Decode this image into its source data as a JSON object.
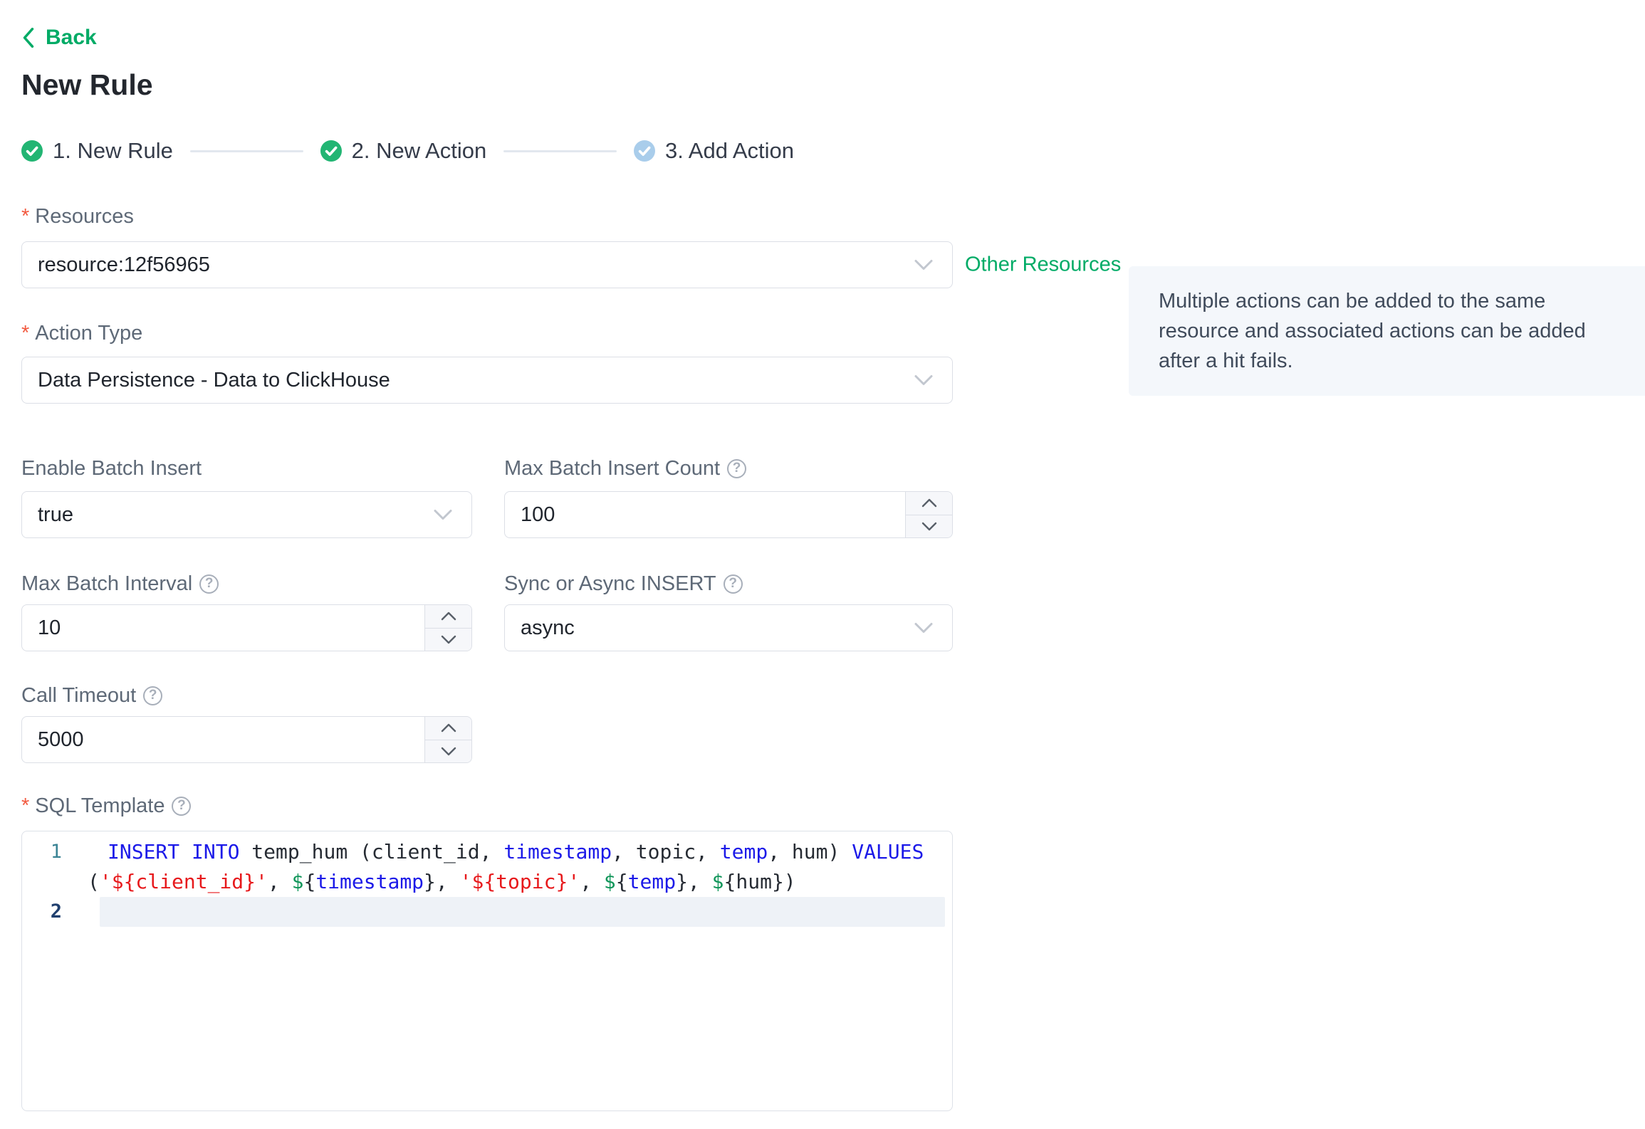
{
  "colors": {
    "accent_green": "#00ab66",
    "step_done_green": "#22b573",
    "step_pending_blue": "#a9cdeb",
    "required_red": "#f25a40",
    "info_box_bg": "#f4f7fb",
    "active_line_bg": "#eef2f7",
    "code_keyword_blue": "#1c1ae8",
    "code_string_red": "#e7191c",
    "code_variable_green": "#109559"
  },
  "marks": {
    "required": "*",
    "help": "?"
  },
  "back": {
    "label": "Back"
  },
  "page_title": "New Rule",
  "stepper": {
    "items": [
      {
        "label": "1. New Rule",
        "state": "done"
      },
      {
        "label": "2. New Action",
        "state": "done"
      },
      {
        "label": "3. Add Action",
        "state": "pending"
      }
    ]
  },
  "form": {
    "resources": {
      "label": "Resources",
      "required": true,
      "value": "resource:12f56965",
      "link_label": "Other Resources"
    },
    "info_box": {
      "text": "Multiple actions can be added to the same resource and associated actions can be added after a hit fails."
    },
    "action_type": {
      "label": "Action Type",
      "required": true,
      "value": "Data Persistence - Data to ClickHouse"
    },
    "enable_batch_insert": {
      "label": "Enable Batch Insert",
      "value": "true"
    },
    "max_batch_insert_count": {
      "label": "Max Batch Insert Count",
      "value": "100"
    },
    "max_batch_interval": {
      "label": "Max Batch Interval",
      "value": "10"
    },
    "sync_or_async_insert": {
      "label": "Sync or Async INSERT",
      "value": "async"
    },
    "call_timeout": {
      "label": "Call Timeout",
      "value": "5000"
    },
    "sql_template": {
      "label": "SQL Template",
      "required": true,
      "value": "INSERT INTO temp_hum (client_id, timestamp, topic, temp, hum) VALUES ('${client_id}', ${timestamp}, '${topic}', ${temp}, ${hum})",
      "rows": [
        {
          "num": "1",
          "indent": 28,
          "active": false,
          "tokens": [
            [
              "INSERT",
              "kw"
            ],
            [
              " ",
              "p"
            ],
            [
              "INTO",
              "kw"
            ],
            [
              " temp_hum (client_id, ",
              "p"
            ],
            [
              "timestamp",
              "kw"
            ],
            [
              ", topic, ",
              "p"
            ],
            [
              "temp",
              "kw"
            ],
            [
              ", hum) ",
              "p"
            ],
            [
              "VALUES",
              "kw"
            ]
          ]
        },
        {
          "num": "",
          "indent": 0,
          "active": false,
          "tokens": [
            [
              "(",
              "p"
            ],
            [
              "'${client_id}'",
              "str"
            ],
            [
              ", ",
              "p"
            ],
            [
              "$",
              "var"
            ],
            [
              "{",
              "p"
            ],
            [
              "timestamp",
              "kw"
            ],
            [
              "}",
              "p"
            ],
            [
              ", ",
              "p"
            ],
            [
              "'${topic}'",
              "str"
            ],
            [
              ", ",
              "p"
            ],
            [
              "$",
              "var"
            ],
            [
              "{",
              "p"
            ],
            [
              "temp",
              "kw"
            ],
            [
              "}",
              "p"
            ],
            [
              ", ",
              "p"
            ],
            [
              "$",
              "var"
            ],
            [
              "{",
              "p"
            ],
            [
              "hum",
              "p"
            ],
            [
              "}",
              "p"
            ],
            [
              ")",
              "p"
            ]
          ]
        },
        {
          "num": "2",
          "indent": 0,
          "active": true,
          "tokens": []
        }
      ]
    }
  }
}
